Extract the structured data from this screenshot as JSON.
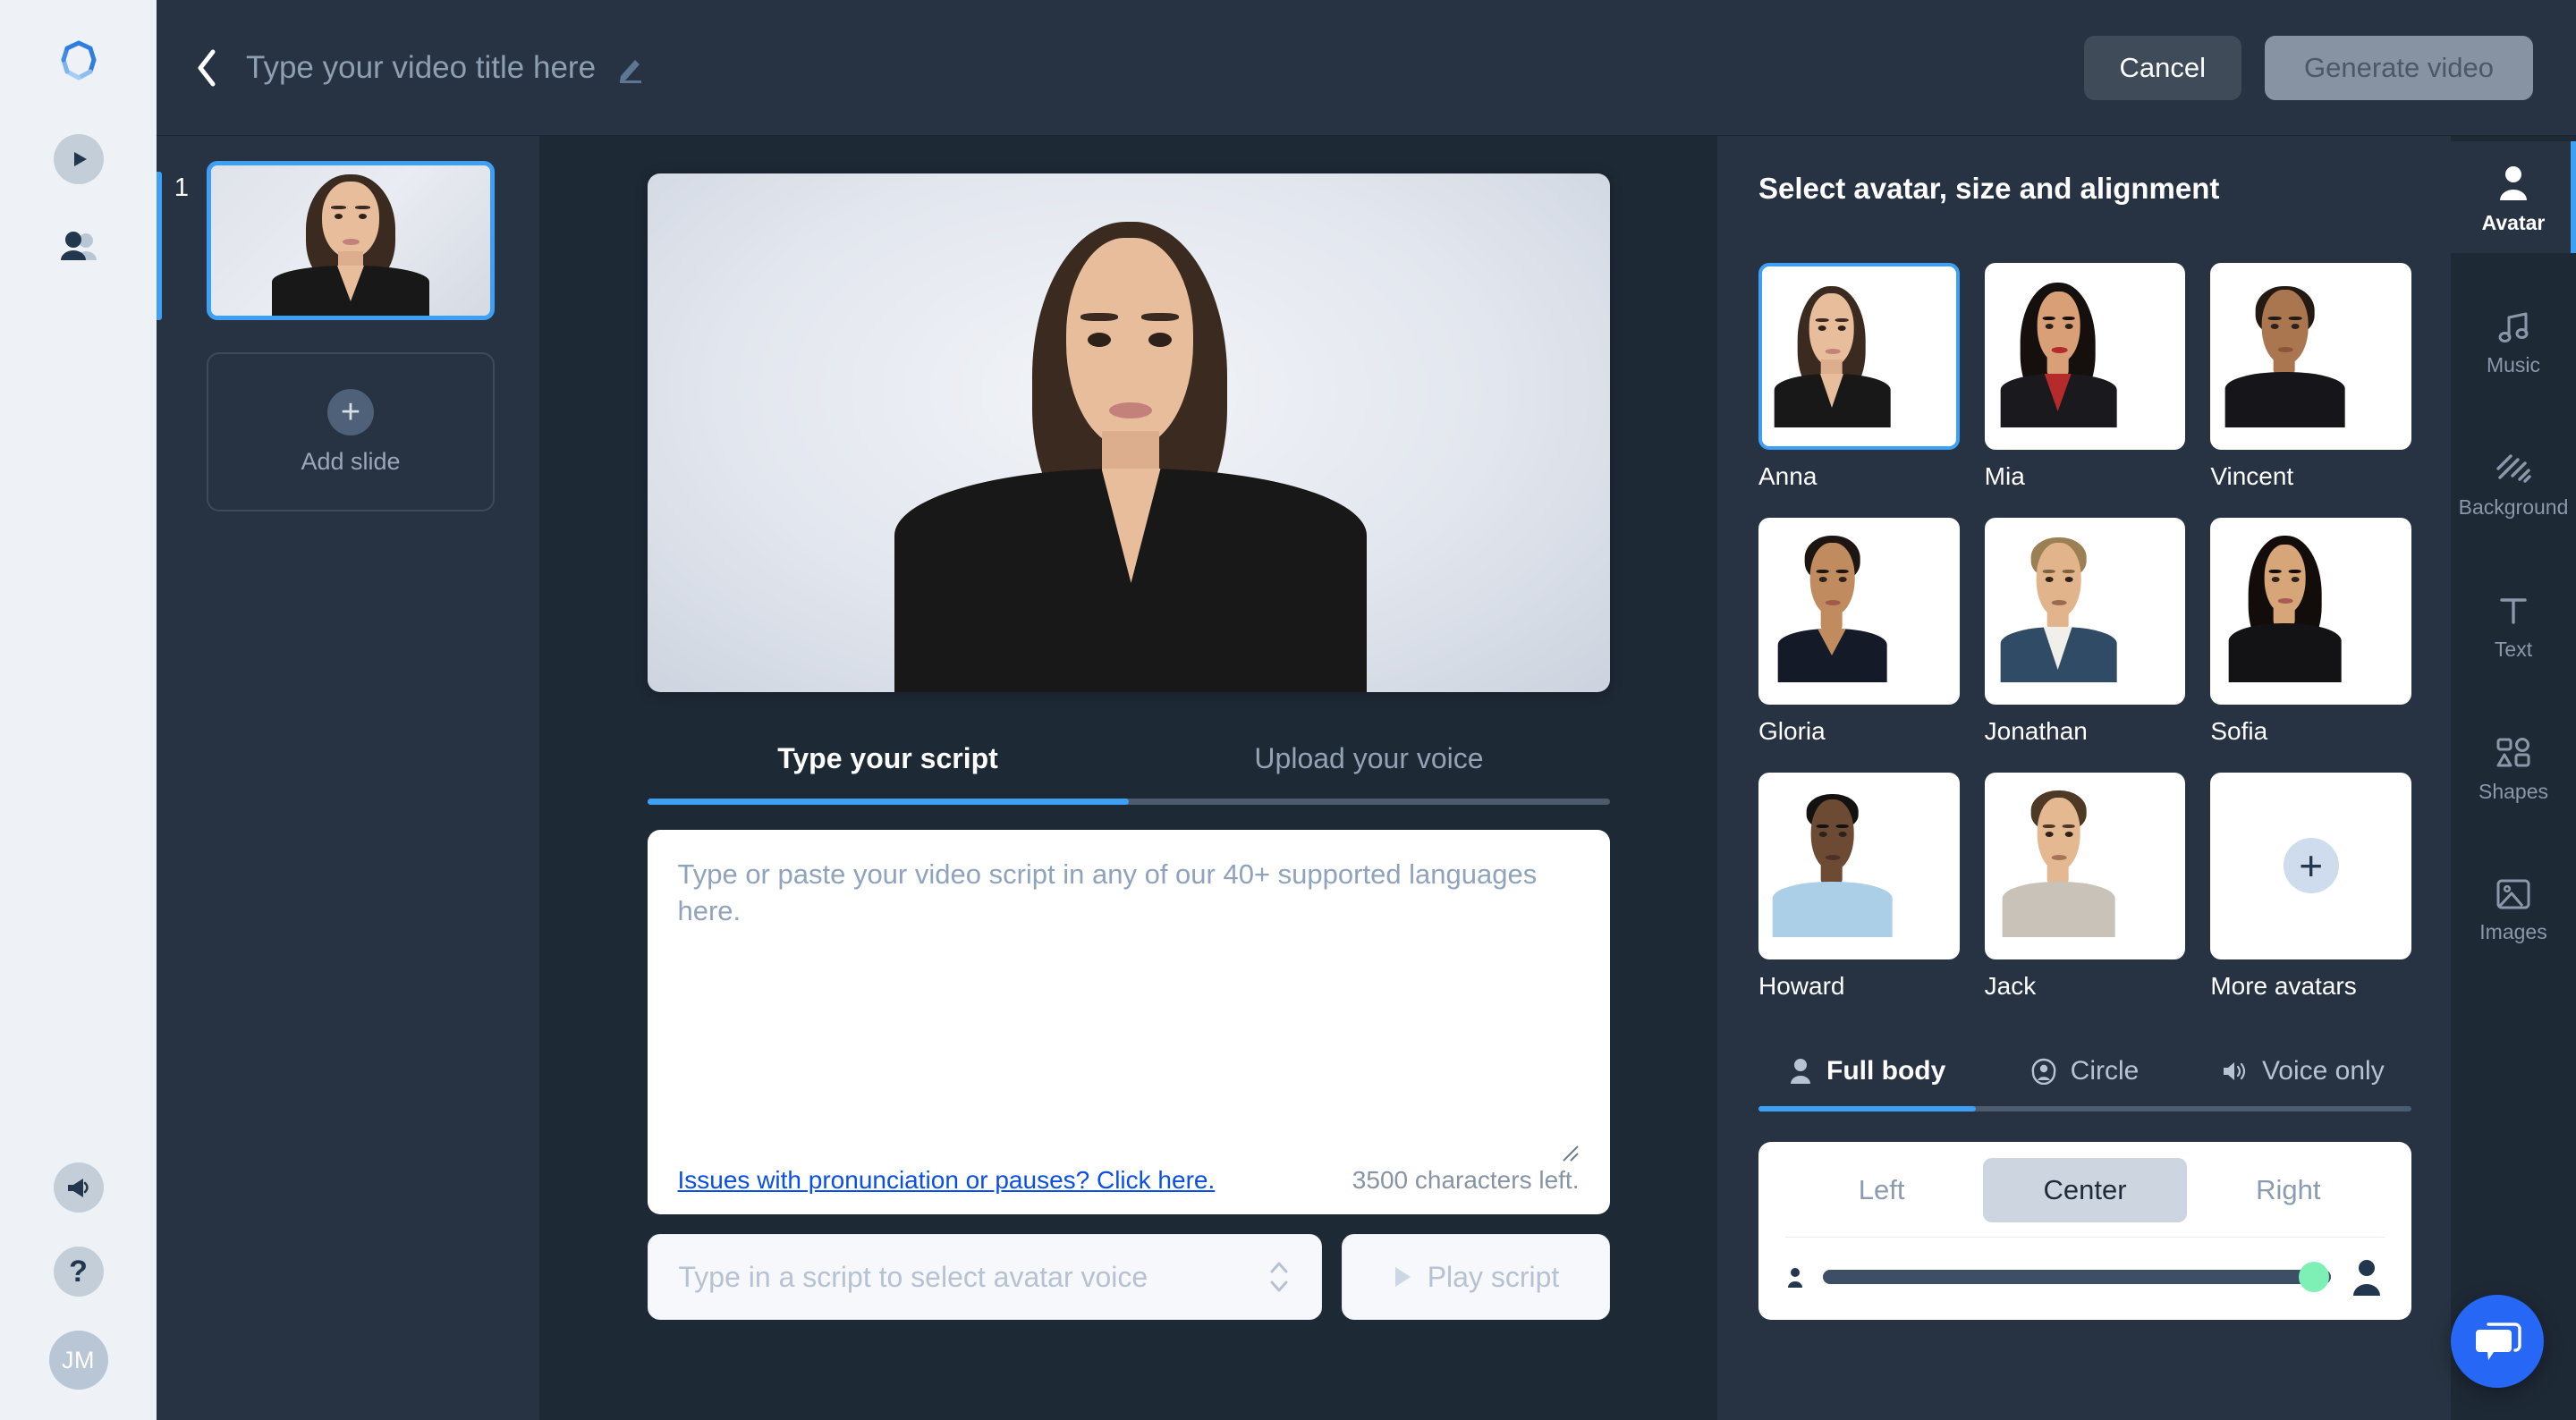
{
  "left_rail": {
    "logo_name": "app-logo",
    "items": [
      {
        "name": "videos",
        "icon": "play-circle-icon"
      },
      {
        "name": "avatars",
        "icon": "people-icon"
      }
    ],
    "bottom_items": [
      {
        "name": "announcements",
        "icon": "megaphone-icon"
      },
      {
        "name": "help",
        "icon": "question-mark-icon"
      }
    ],
    "user_initials": "JM"
  },
  "topbar": {
    "back_icon": "chevron-left-icon",
    "title": "Type your video title here",
    "edit_icon": "pencil-icon",
    "cancel_label": "Cancel",
    "generate_label": "Generate video"
  },
  "slides": {
    "items": [
      {
        "number": "1",
        "selected": true
      }
    ],
    "add_slide_label": "Add slide",
    "add_icon": "plus-icon"
  },
  "script": {
    "tabs": [
      {
        "label": "Type your script",
        "active": true
      },
      {
        "label": "Upload your voice",
        "active": false
      }
    ],
    "placeholder": "Type or paste your video script in any of our 40+ supported languages here.",
    "pronunciation_link": "Issues with pronunciation or pauses? Click here.",
    "characters_left": "3500 characters left.",
    "voice_placeholder": "Type in a script to select avatar voice",
    "play_label": "Play script",
    "play_icon": "play-triangle-icon",
    "stepper_icon": "up-down-chevron-icon",
    "resize_icon": "resize-grip-icon"
  },
  "right_panel": {
    "title": "Select avatar, size and alignment",
    "avatars": [
      {
        "name": "Anna",
        "selected": true
      },
      {
        "name": "Mia",
        "selected": false
      },
      {
        "name": "Vincent",
        "selected": false
      },
      {
        "name": "Gloria",
        "selected": false
      },
      {
        "name": "Jonathan",
        "selected": false
      },
      {
        "name": "Sofia",
        "selected": false
      },
      {
        "name": "Howard",
        "selected": false
      },
      {
        "name": "Jack",
        "selected": false
      },
      {
        "name": "More avatars",
        "selected": false,
        "is_more": true
      }
    ],
    "mode_tabs": [
      {
        "label": "Full body",
        "icon": "person-icon",
        "active": true
      },
      {
        "label": "Circle",
        "icon": "circle-person-icon",
        "active": false
      },
      {
        "label": "Voice only",
        "icon": "speaker-icon",
        "active": false
      }
    ],
    "alignment": {
      "options": [
        {
          "label": "Left",
          "active": false
        },
        {
          "label": "Center",
          "active": true
        },
        {
          "label": "Right",
          "active": false
        }
      ],
      "size_min_icon": "small-person-icon",
      "size_max_icon": "large-person-icon",
      "size_value": 100
    }
  },
  "tool_rail": [
    {
      "label": "Avatar",
      "icon": "person-icon",
      "active": true
    },
    {
      "label": "Music",
      "icon": "music-note-icon",
      "active": false
    },
    {
      "label": "Background",
      "icon": "hatch-pattern-icon",
      "active": false
    },
    {
      "label": "Text",
      "icon": "text-t-icon",
      "active": false
    },
    {
      "label": "Shapes",
      "icon": "shapes-icon",
      "active": false
    },
    {
      "label": "Images",
      "icon": "image-icon",
      "active": false
    }
  ],
  "chat": {
    "icon": "chat-bubble-icon"
  },
  "colors": {
    "accent_blue": "#3da0f5",
    "panel_bg": "#273342",
    "canvas_bg": "#1e2936",
    "rail_bg": "#eef1f6",
    "link_blue": "#0a4fe8",
    "slider_green": "#7ef0b6",
    "chat_blue": "#2667f5"
  }
}
